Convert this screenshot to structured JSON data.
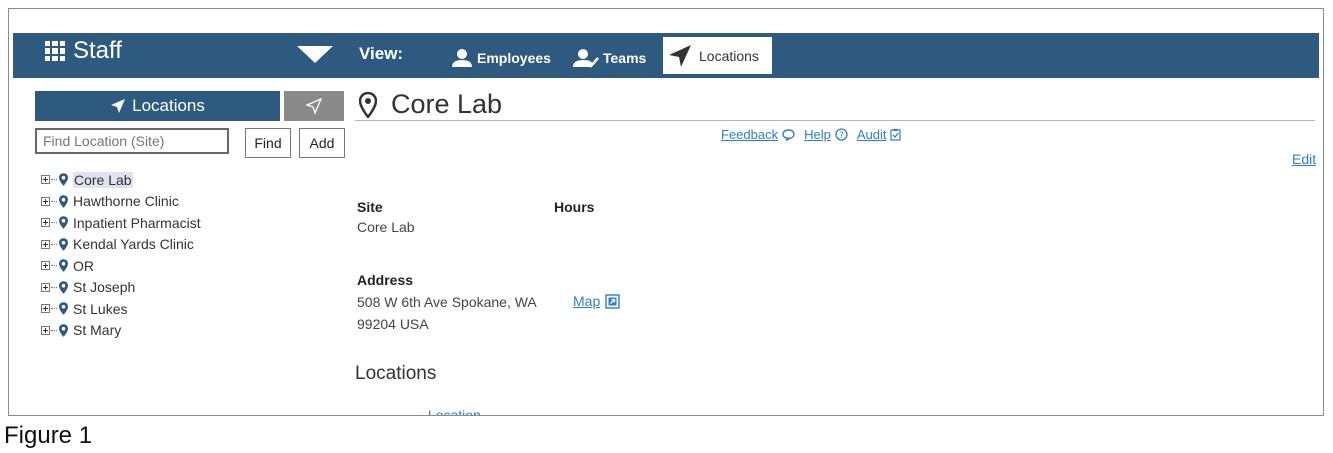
{
  "header": {
    "app_title": "Staff",
    "view_label": "View:",
    "tabs": [
      {
        "label": "Employees",
        "active": false
      },
      {
        "label": "Teams",
        "active": false
      },
      {
        "label": "Locations",
        "active": true
      }
    ]
  },
  "sidebar": {
    "locations_button": "Locations",
    "search_placeholder": "Find Location (Site)",
    "find_label": "Find",
    "add_label": "Add",
    "tree": [
      {
        "label": "Core Lab",
        "selected": true
      },
      {
        "label": "Hawthorne Clinic",
        "selected": false
      },
      {
        "label": "Inpatient Pharmacist",
        "selected": false
      },
      {
        "label": "Kendal Yards Clinic",
        "selected": false
      },
      {
        "label": "OR",
        "selected": false
      },
      {
        "label": "St Joseph",
        "selected": false
      },
      {
        "label": "St Lukes",
        "selected": false
      },
      {
        "label": "St Mary",
        "selected": false
      }
    ]
  },
  "main": {
    "title": "Core Lab",
    "links": {
      "feedback": "Feedback",
      "help": "Help",
      "audit": "Audit"
    },
    "edit_label": "Edit",
    "site_label": "Site",
    "site_value": "Core Lab",
    "hours_label": "Hours",
    "address_label": "Address",
    "address_line1": "508 W 6th Ave Spokane, WA",
    "address_line2": "99204 USA",
    "map_label": "Map",
    "locations_heading": "Locations",
    "location_column": "Location"
  },
  "caption": "Figure 1",
  "colors": {
    "header_bg": "#2f5a7f",
    "link": "#2e7fc4",
    "nav_gray": "#8a8a8a"
  }
}
